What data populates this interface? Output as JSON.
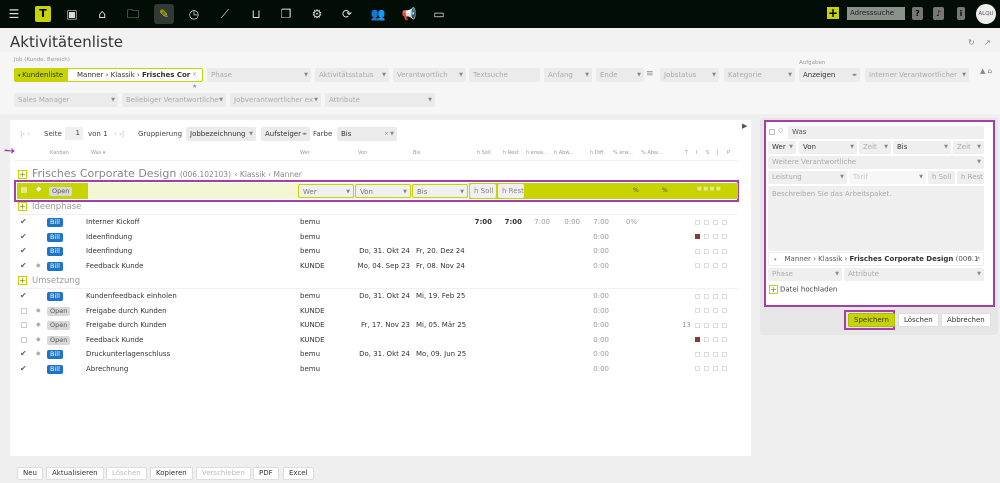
{
  "topbar": {
    "icons": [
      "menu-icon",
      "logo-icon",
      "calendar-icon",
      "home-location-icon",
      "folder-icon",
      "activity-list-icon",
      "clock-icon",
      "chart-icon",
      "cart-icon",
      "documents-icon",
      "gear-icon",
      "refresh-icon",
      "team-icon",
      "megaphone-icon",
      "chat-icon"
    ],
    "logo": "T",
    "address_search": "Adresssuche",
    "help": "?",
    "avatar": "ALQU"
  },
  "page": {
    "title": "Aktivitätenliste"
  },
  "filters": {
    "job_label": "Job (Kunde, Bereich)",
    "kundenliste": "Kundenliste",
    "job_value_1": "Manner",
    "job_value_2": "Klassik",
    "job_value_3": "Frisches Cor",
    "phase": "Phase",
    "aktivitaetsstatus": "Aktivitätsstatus",
    "verantwortlich": "Verantwortlich",
    "textsuche": "Textsuche",
    "anfang": "Anfang",
    "ende": "Ende",
    "jobstatus": "Jobstatus",
    "kategorie": "Kategorie",
    "aufgaben_label": "Aufgaben",
    "aufgaben_value": "Anzeigen",
    "interner": "Interner Verantwortlicher",
    "sales_manager": "Sales Manager",
    "beliebiger": "Beliebiger Verantwortliche",
    "jobverantwortlicher": "Jobverantwortlicher ex",
    "attribute": "Attribute"
  },
  "pager": {
    "seite": "Seite",
    "page": "1",
    "von": "von 1",
    "gruppierung": "Gruppierung",
    "gruppierung_value": "Jobbezeichnung",
    "sort": "Aufsteiger",
    "farbe": "Farbe",
    "farbe_value": "Bis"
  },
  "columns": {
    "kanban": "Kanban",
    "was": "Was ▾",
    "wer": "Wer",
    "von": "Von",
    "bis": "Bis",
    "hsoll": "h Soll",
    "hrest": "h Rest",
    "herwa": "h erwa...",
    "habw": "h Abw...",
    "hdiff": "h Diff.",
    "perw": "% erw...",
    "pabw": "% Abw...",
    "t": "T",
    "i": "I",
    "s": "S",
    "j": "J",
    "p": "P"
  },
  "job": {
    "title": "Frisches Corporate Design",
    "number": "(006.102103)",
    "crumb": "‹ Klassik ‹ Manner"
  },
  "edit_row": {
    "status": "Open",
    "wer": "Wer",
    "von": "Von",
    "bis": "Bis",
    "hsoll": "h Soll",
    "hrest": "h Rest",
    "p1": "%",
    "p2": "%"
  },
  "groups": [
    {
      "name": "Ideenphase",
      "rows": [
        {
          "done": true,
          "diamond": false,
          "status": "Bill",
          "was": "Interner Kickoff",
          "wer": "bemu",
          "von": "",
          "bis": "",
          "hsoll": "7:00",
          "hrest": "7:00",
          "herwa": "7:00",
          "habw": "0:00",
          "hdiff": "7:00",
          "perw": "0%",
          "extra": "",
          "red": false
        },
        {
          "done": true,
          "diamond": false,
          "status": "Bill",
          "was": "Ideenfindung",
          "wer": "bemu",
          "von": "",
          "bis": "",
          "hsoll": "",
          "hrest": "",
          "herwa": "",
          "habw": "",
          "hdiff": "0:00",
          "perw": "",
          "extra": "",
          "red": true
        },
        {
          "done": true,
          "diamond": false,
          "status": "Bill",
          "was": "Ideenfindung",
          "wer": "bemu",
          "von": "Do, 31. Okt 24",
          "bis": "Fr, 20. Dez 24",
          "hsoll": "",
          "hrest": "",
          "herwa": "",
          "habw": "",
          "hdiff": "0:00",
          "perw": "",
          "extra": "",
          "red": false
        },
        {
          "done": true,
          "diamond": true,
          "status": "Bill",
          "was": "Feedback Kunde",
          "wer": "KUNDE",
          "von": "Mo, 04. Sep 23",
          "bis": "Fr, 08. Nov 24",
          "hsoll": "",
          "hrest": "",
          "herwa": "",
          "habw": "",
          "hdiff": "0:00",
          "perw": "",
          "extra": "",
          "red": false
        }
      ]
    },
    {
      "name": "Umsetzung",
      "rows": [
        {
          "done": true,
          "diamond": false,
          "status": "Bill",
          "was": "Kundenfeedback einholen",
          "wer": "bemu",
          "von": "Do, 31. Okt 24",
          "bis": "Mi, 19. Feb 25",
          "hsoll": "",
          "hrest": "",
          "herwa": "",
          "habw": "",
          "hdiff": "0:00",
          "perw": "",
          "extra": "",
          "red": false
        },
        {
          "done": false,
          "diamond": true,
          "status": "Open",
          "was": "Freigabe durch Kunden",
          "wer": "KUNDE",
          "von": "",
          "bis": "",
          "hsoll": "",
          "hrest": "",
          "herwa": "",
          "habw": "",
          "hdiff": "0:00",
          "perw": "",
          "extra": "",
          "red": false
        },
        {
          "done": false,
          "diamond": true,
          "status": "Open",
          "was": "Freigabe durch Kunden",
          "wer": "KUNDE",
          "von": "Fr, 17. Nov 23",
          "bis": "Mi, 05. Mär 25",
          "hsoll": "",
          "hrest": "",
          "herwa": "",
          "habw": "",
          "hdiff": "0:00",
          "perw": "",
          "extra": "13",
          "red": false
        },
        {
          "done": false,
          "diamond": true,
          "status": "Open",
          "was": "Feedback Kunde",
          "wer": "KUNDE",
          "von": "",
          "bis": "",
          "hsoll": "",
          "hrest": "",
          "herwa": "",
          "habw": "",
          "hdiff": "0:00",
          "perw": "",
          "extra": "",
          "red": true
        },
        {
          "done": true,
          "diamond": true,
          "status": "Bill",
          "was": "Druckunterlagenschluss",
          "wer": "bemu",
          "von": "Do, 31. Okt 24",
          "bis": "Mo, 09. Jun 25",
          "hsoll": "",
          "hrest": "",
          "herwa": "",
          "habw": "",
          "hdiff": "0:00",
          "perw": "",
          "extra": "",
          "red": false
        },
        {
          "done": true,
          "diamond": false,
          "status": "Bill",
          "was": "Abrechnung",
          "wer": "bemu",
          "von": "",
          "bis": "",
          "hsoll": "",
          "hrest": "",
          "herwa": "",
          "habw": "",
          "hdiff": "0:00",
          "perw": "",
          "extra": "",
          "red": false
        }
      ]
    }
  ],
  "footer": {
    "neu": "Neu",
    "aktualisieren": "Aktualisieren",
    "loeschen": "Löschen",
    "kopieren": "Kopieren",
    "verschieben": "Verschieben",
    "pdf": "PDF",
    "excel": "Excel"
  },
  "side": {
    "was": "Was",
    "wer": "Wer",
    "von": "Von",
    "zeit1": "Zeit",
    "bis": "Bis",
    "zeit2": "Zeit",
    "weitere": "Weitere Verantwortliche",
    "leistung": "Leistung",
    "tarif": "Tarif",
    "hsoll": "h Soll",
    "hrest": "h Rest",
    "beschreibung": "Beschreiben Sie das Arbeitspaket.",
    "job_1": "Manner",
    "job_2": "Klassik",
    "job_3": "Frisches Corporate Design",
    "job_4": "(006.1",
    "phase": "Phase",
    "attribute": "Attribute",
    "upload": "Datei hochladen",
    "speichern": "Speichern",
    "loeschen": "Löschen",
    "abbrechen": "Abbrechen"
  },
  "colors": {
    "accent": "#c8d400",
    "highlight": "#a040a8",
    "bill": "#1e74c9"
  }
}
